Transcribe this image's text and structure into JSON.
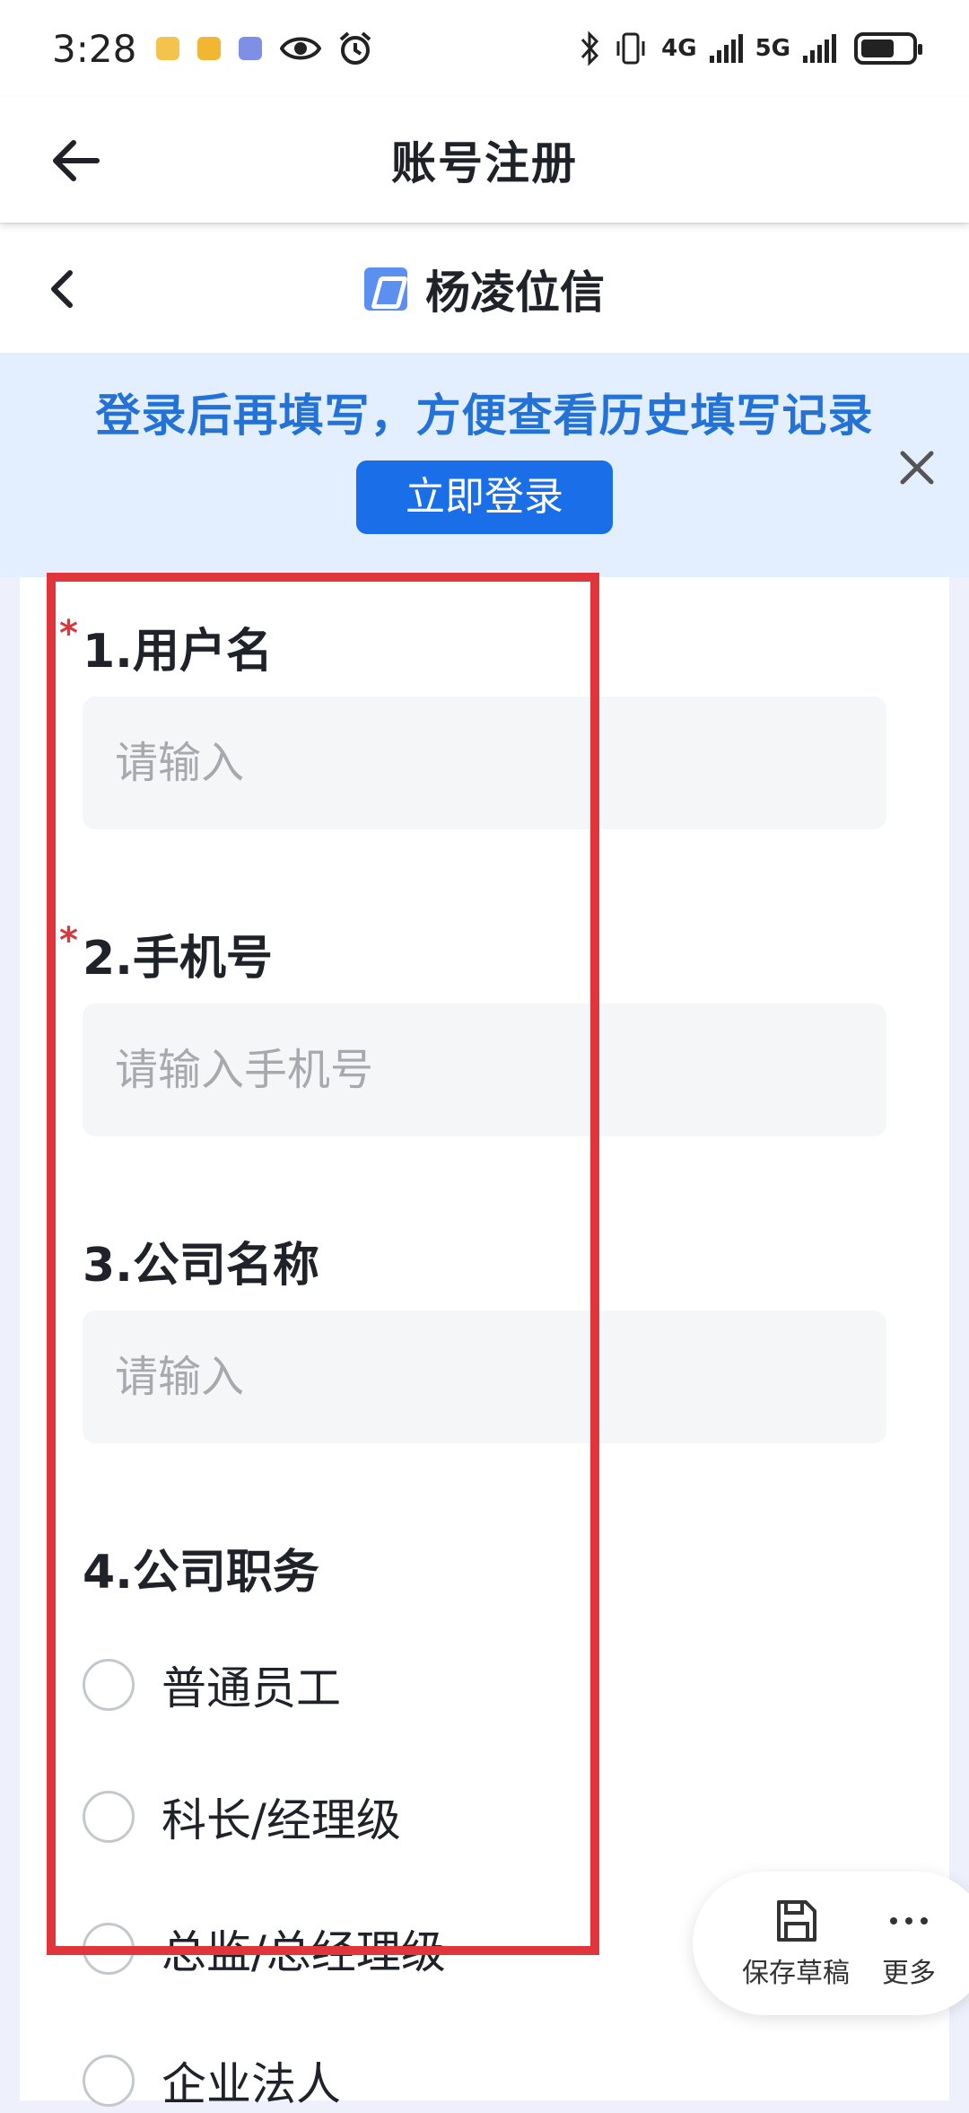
{
  "status_bar": {
    "time": "3:28",
    "network_1": "4G",
    "network_2": "5G"
  },
  "header": {
    "title": "账号注册"
  },
  "sub_header": {
    "brand_name": "杨凌位信"
  },
  "login_banner": {
    "message": "登录后再填写，方便查看历史填写记录",
    "button_label": "立即登录"
  },
  "form": {
    "q1": {
      "label": "1.用户名",
      "required_mark": "*",
      "placeholder": "请输入"
    },
    "q2": {
      "label": "2.手机号",
      "required_mark": "*",
      "placeholder": "请输入手机号"
    },
    "q3": {
      "label": "3.公司名称",
      "placeholder": "请输入"
    },
    "q4": {
      "label": "4.公司职务",
      "options": [
        "普通员工",
        "科长/经理级",
        "总监/总经理级",
        "企业法人"
      ]
    }
  },
  "fab": {
    "save_draft": "保存草稿",
    "more": "更多"
  },
  "colors": {
    "accent": "#1a6fe8",
    "banner_text": "#2472d6",
    "required": "#d9363e",
    "highlight_box": "#e0353b"
  }
}
